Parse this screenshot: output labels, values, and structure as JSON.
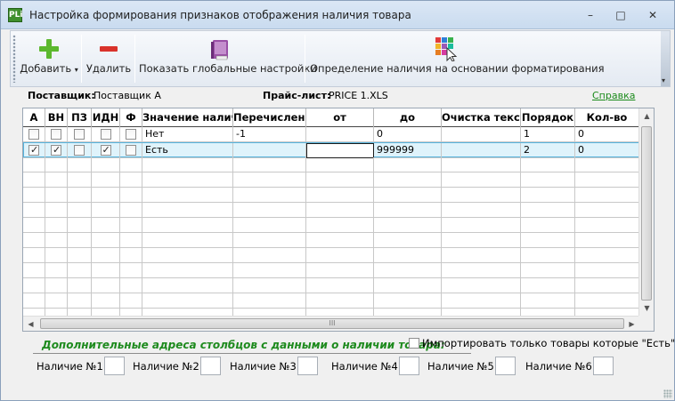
{
  "window": {
    "title": "Настройка формирования признаков отображения наличия товара",
    "app_icon": "PLi",
    "minimize": "–",
    "maximize": "□",
    "close": "✕"
  },
  "toolbar": {
    "add_label": "Добавить",
    "delete_label": "Удалить",
    "global_settings_label": "Показать глобальные настройки",
    "format_label": "Определение наличия на основании форматирования",
    "overflow_glyph": "▾"
  },
  "info": {
    "supplier_label": "Поставщик:",
    "supplier_value": "Поставщик А",
    "pricelist_label": "Прайс-лист:",
    "pricelist_value": "PRICE 1.XLS",
    "help_label": "Справка"
  },
  "grid": {
    "columns": [
      "А",
      "ВН",
      "ПЗ",
      "ИДН",
      "Ф",
      "Значение налич",
      "Перечислени",
      "от",
      "до",
      "Очистка текст",
      "Порядок",
      "Кол-во"
    ],
    "rows": [
      {
        "a": false,
        "vn": false,
        "pz": false,
        "idn": false,
        "f": false,
        "value": "Нет",
        "enum": "-1",
        "from": "",
        "to": "0",
        "clear": "",
        "order": "1",
        "qty": "0",
        "selected": false
      },
      {
        "a": true,
        "vn": true,
        "pz": false,
        "idn": true,
        "f": false,
        "value": "Есть",
        "enum": "",
        "from": "",
        "to": "999999",
        "clear": "",
        "order": "2",
        "qty": "0",
        "selected": true
      }
    ],
    "scroll_up": "▲",
    "scroll_down": "▼",
    "scroll_left": "◀",
    "scroll_right": "▶",
    "thumb_grip": "III"
  },
  "addresses": {
    "title": "Дополнительные адреса столбцов с данными о наличии товара:",
    "only_yes_label": "Импортировать только товары которые \"Есть\"",
    "only_yes_checked": false,
    "fields": [
      {
        "label": "Наличие №1:",
        "value": ""
      },
      {
        "label": "Наличие №2:",
        "value": ""
      },
      {
        "label": "Наличие №3:",
        "value": ""
      },
      {
        "label": "Наличие №4:",
        "value": ""
      },
      {
        "label": "Наличие №5:",
        "value": ""
      },
      {
        "label": "Наличие №6:",
        "value": ""
      }
    ]
  },
  "colors": {
    "title_bg": "#c9dbef",
    "accent_green": "#1d8a1d",
    "selection_border": "#57b4dd",
    "selection_bg": "#dff3fb",
    "add_icon": "#5cb82e",
    "delete_icon": "#d9322b"
  }
}
